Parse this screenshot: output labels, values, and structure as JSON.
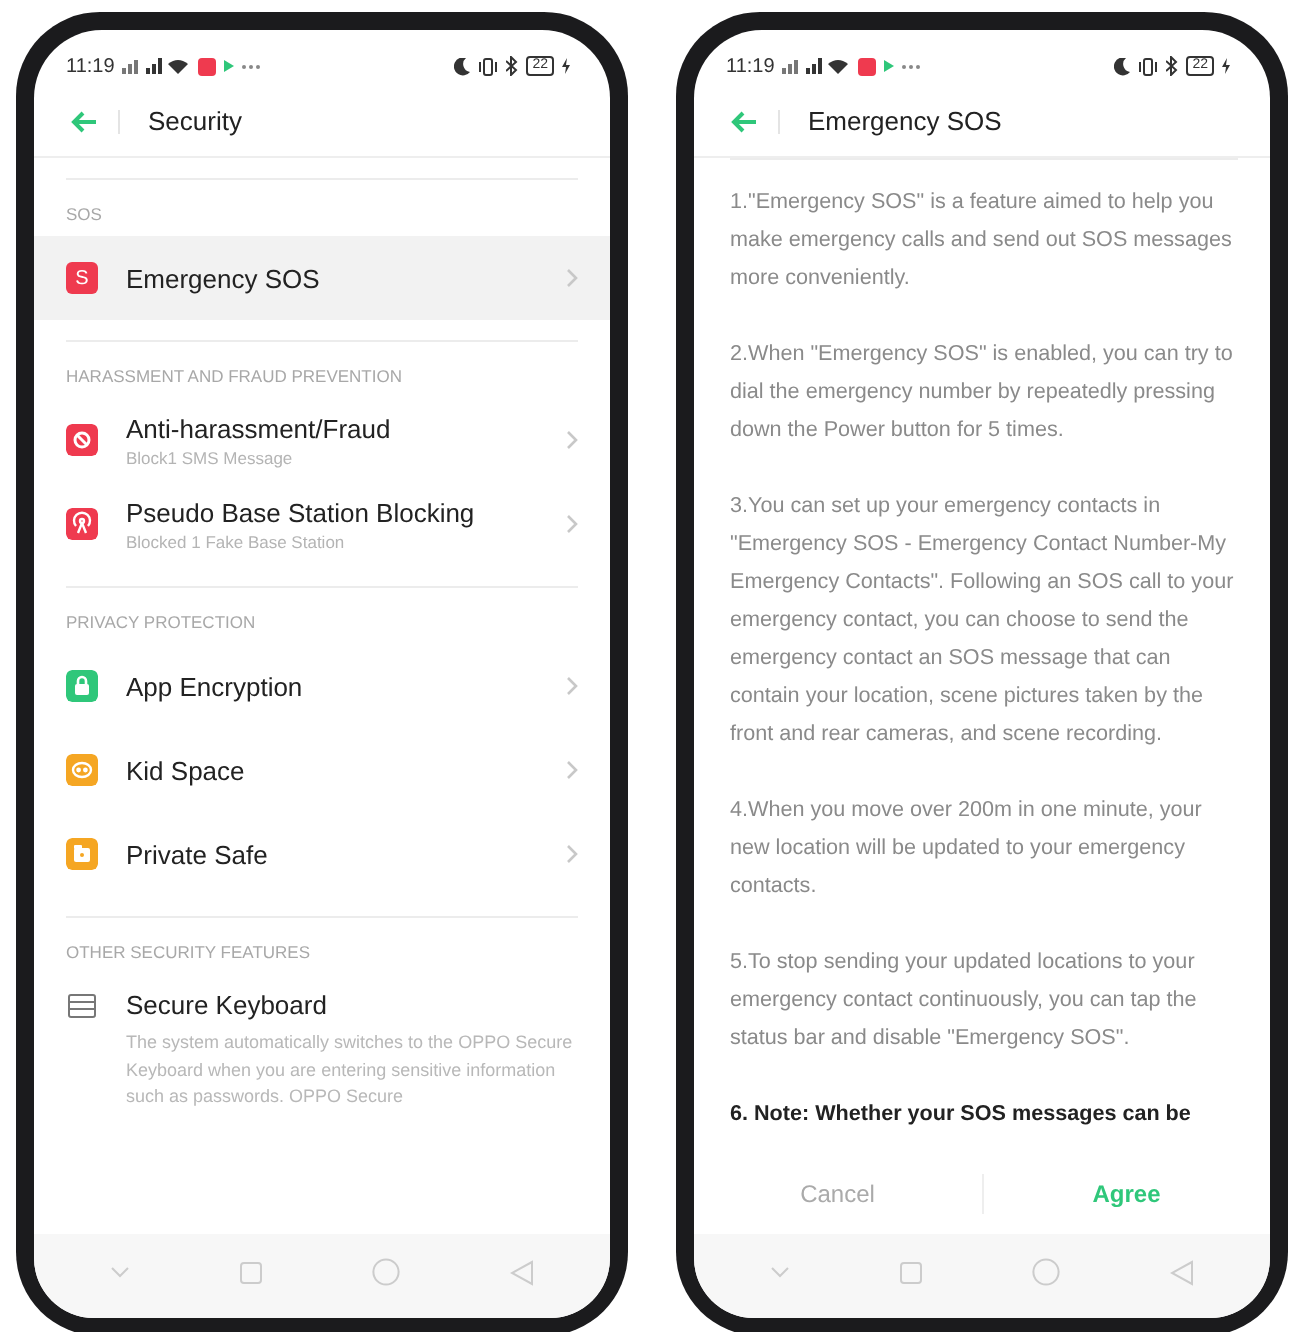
{
  "phones": [
    {
      "status_bar": {
        "time": "11:19",
        "battery": "22"
      },
      "header": {
        "title": "Security"
      },
      "sections": [
        {
          "title": "SOS",
          "items": [
            {
              "label": "Emergency SOS",
              "kind": "letter",
              "icon_text": "S",
              "color": "#ef3a4f",
              "selected": true
            }
          ]
        },
        {
          "title": "HARASSMENT AND FRAUD PREVENTION",
          "items": [
            {
              "label": "Anti-harassment/Fraud",
              "subtitle": "Block1 SMS Message",
              "kind": "block",
              "color": "#ef3a4f",
              "selected": false
            },
            {
              "label": "Pseudo Base Station Blocking",
              "subtitle": "Blocked 1 Fake Base Station",
              "kind": "antenna",
              "color": "#ef3a4f",
              "selected": false
            }
          ]
        },
        {
          "title": "PRIVACY PROTECTION",
          "items": [
            {
              "label": "App Encryption",
              "kind": "lock",
              "color": "#2fc77a",
              "selected": false
            },
            {
              "label": "Kid Space",
              "kind": "face",
              "color": "#f5a623",
              "selected": false
            },
            {
              "label": "Private Safe",
              "kind": "safe",
              "color": "#f5a623",
              "selected": false
            }
          ]
        },
        {
          "title": "OTHER SECURITY FEATURES",
          "items": [
            {
              "label": "Secure Keyboard",
              "description": "The system automatically switches to the OPPO Secure Keyboard when you are entering sensitive information such as passwords. OPPO Secure",
              "kind": "keyboard",
              "selected": false
            }
          ]
        }
      ]
    },
    {
      "status_bar": {
        "time": "11:19",
        "battery": "22"
      },
      "header": {
        "title": "Emergency SOS"
      },
      "paragraphs": [
        {
          "kind": "plain",
          "text": "1.\"Emergency SOS\" is a feature aimed to help you make emergency calls and send out SOS messages more conveniently."
        },
        {
          "kind": "plain",
          "text": "2.When \"Emergency SOS\" is enabled, you can try to dial the emergency number by repeatedly pressing down the Power button for 5 times."
        },
        {
          "kind": "plain",
          "text": "3.You can set up your emergency contacts in \"Emergency SOS - Emergency Contact Number-My Emergency Contacts\". Following an SOS call to your emergency contact, you can choose to send the emergency contact an SOS message that can contain your location, scene pictures taken by the front and rear cameras, and scene recording."
        },
        {
          "kind": "plain",
          "text": "4.When you move over 200m in one minute, your new location will be updated to your emergency contacts."
        },
        {
          "kind": "plain",
          "text": "5.To stop sending your updated locations to your emergency contact continuously, you can tap the status bar and disable \"Emergency SOS\"."
        },
        {
          "kind": "bold",
          "text": "6. Note: Whether your SOS messages can be"
        }
      ],
      "buttons": [
        {
          "label": "Cancel",
          "kind": "plain"
        },
        {
          "label": "Agree",
          "kind": "primary"
        }
      ]
    }
  ]
}
